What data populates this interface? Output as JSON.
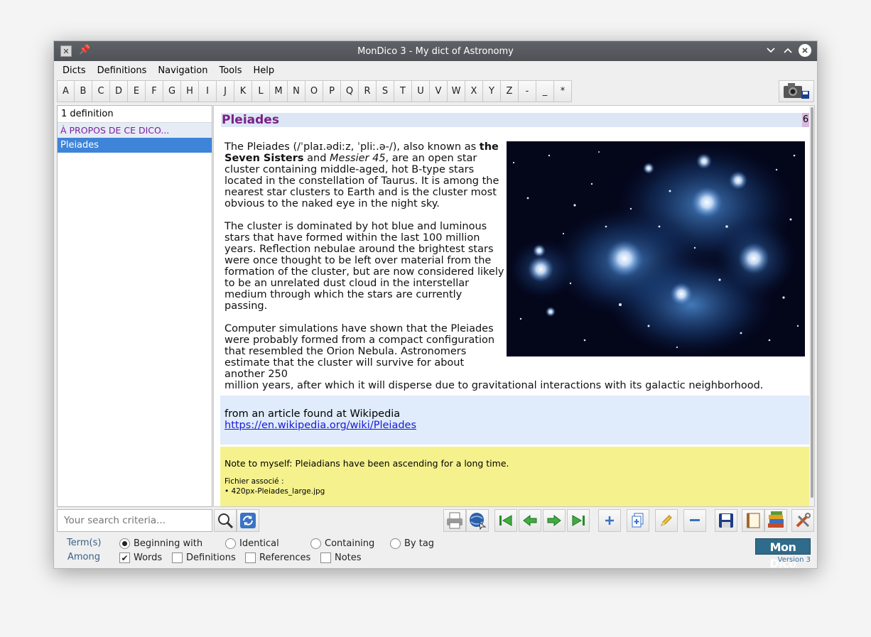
{
  "window": {
    "title": "MonDico 3 - My dict of Astronomy"
  },
  "menu": [
    "Dicts",
    "Definitions",
    "Navigation",
    "Tools",
    "Help"
  ],
  "letters": [
    "A",
    "B",
    "C",
    "D",
    "E",
    "F",
    "G",
    "H",
    "I",
    "J",
    "K",
    "L",
    "M",
    "N",
    "O",
    "P",
    "Q",
    "R",
    "S",
    "T",
    "U",
    "V",
    "W",
    "X",
    "Y",
    "Z",
    "-",
    "_",
    "*"
  ],
  "list": {
    "count": "1 definition",
    "entries": [
      "À PROPOS DE CE DICO...",
      "Pleiades"
    ],
    "selected_index": 1
  },
  "definition": {
    "word": "Pleiades",
    "number": "6",
    "p1_a": "The Pleiades (/ˈplaɪ.ədiːz, ˈpliː.ə-/), also known as ",
    "p1_bold": "the Seven Sisters",
    "p1_b": " and ",
    "p1_italic": "Messier 45",
    "p1_c": ", are an open star cluster containing middle-aged, hot B-type stars located in the constellation of Taurus. It is among the nearest star clusters to Earth and is the cluster most obvious to the naked eye in the night sky.",
    "p2": "The cluster is dominated by hot blue and luminous stars that have formed within the last 100 million years. Reflection nebulae around the brightest stars were once thought to be left over material from the formation of the cluster, but are now considered likely to be an unrelated dust cloud in the interstellar medium through which the stars are currently passing.",
    "p3_col": "Computer simulations have shown that the Pleiades were probably formed from a compact configuration that resembled the Orion Nebula. Astronomers estimate that the cluster will survive for about another 250",
    "p3_full": "million years, after which it will disperse due to gravitational interactions with its galactic neighborhood.",
    "source_text": "from an article found at Wikipedia",
    "source_url": "https://en.wikipedia.org/wiki/Pleiades",
    "note": "Note to myself: Pleiadians have been ascending for a long time.",
    "assoc_label": "Fichier associé :",
    "assoc_file": "• 420px-Pleiades_large.jpg"
  },
  "search": {
    "placeholder": "Your search criteria..."
  },
  "toolbar": {
    "icons": [
      "search-icon",
      "refresh-icon",
      "print-icon",
      "web-icon",
      "first-icon",
      "previous-icon",
      "next-icon",
      "last-icon",
      "add-icon",
      "duplicate-icon",
      "edit-icon",
      "remove-icon",
      "save-icon",
      "book-icon",
      "books-icon",
      "tools-icon"
    ]
  },
  "options": {
    "terms_label": "Term(s)",
    "among_label": "Among",
    "radios": [
      {
        "label": "Beginning with",
        "checked": true
      },
      {
        "label": "Identical",
        "checked": false
      },
      {
        "label": "Containing",
        "checked": false
      },
      {
        "label": "By tag",
        "checked": false
      }
    ],
    "checks": [
      {
        "label": "Words",
        "checked": true
      },
      {
        "label": "Definitions",
        "checked": false
      },
      {
        "label": "References",
        "checked": false
      },
      {
        "label": "Notes",
        "checked": false
      }
    ]
  },
  "logo": {
    "text": "Mon Dico",
    "version": "Version 3"
  },
  "colors": {
    "accent": "#3e84d8",
    "word": "#7a1f86",
    "note_bg": "#f5f28e",
    "source_bg": "#e0ebfb"
  }
}
